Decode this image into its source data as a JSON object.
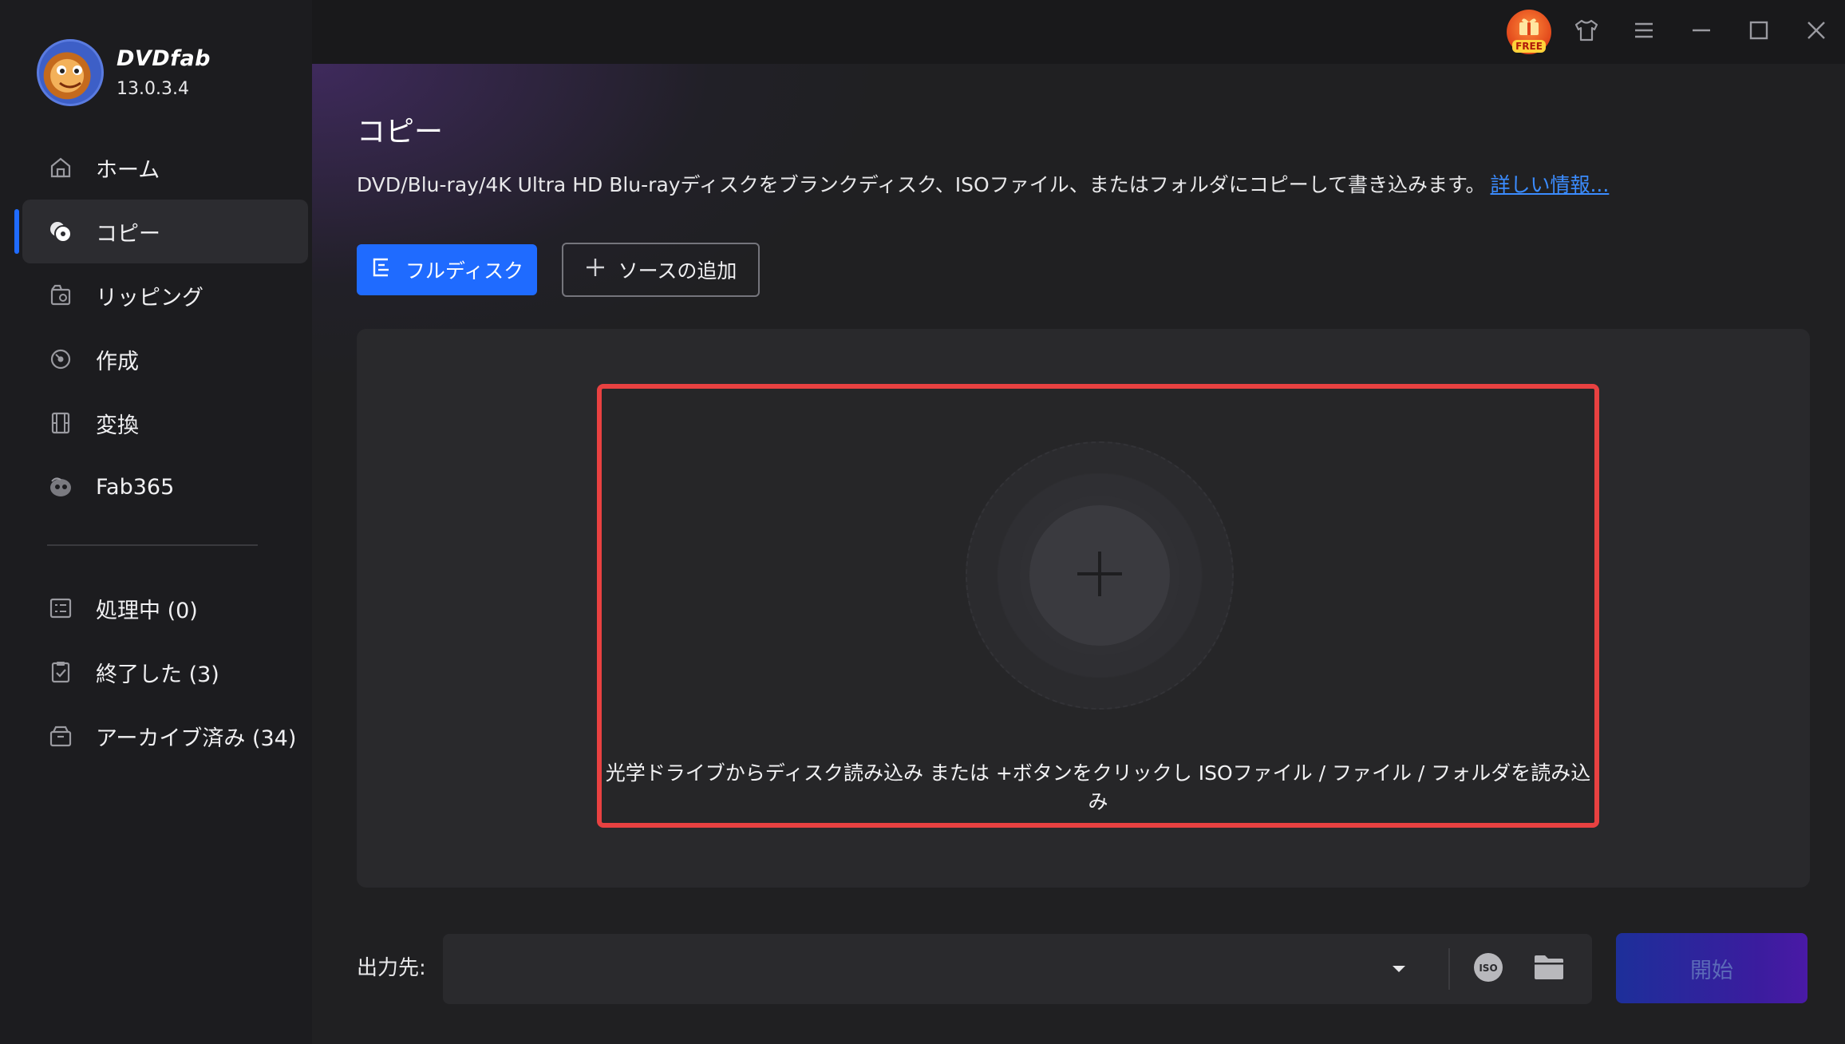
{
  "app": {
    "name": "DVDfab",
    "version": "13.0.3.4"
  },
  "nav": {
    "items": [
      {
        "label": "ホーム",
        "icon": "home-icon"
      },
      {
        "label": "コピー",
        "icon": "copy-disc-icon",
        "active": true
      },
      {
        "label": "リッピング",
        "icon": "ripper-icon"
      },
      {
        "label": "作成",
        "icon": "creator-icon"
      },
      {
        "label": "変換",
        "icon": "converter-icon"
      },
      {
        "label": "Fab365",
        "icon": "fab365-icon"
      }
    ],
    "queue": [
      {
        "label": "処理中 (0)",
        "icon": "processing-icon"
      },
      {
        "label": "終了した (3)",
        "icon": "finished-icon"
      },
      {
        "label": "アーカイブ済み (34)",
        "icon": "archive-icon"
      }
    ]
  },
  "topbar": {
    "free_badge": "FREE"
  },
  "main": {
    "title": "コピー",
    "description": "DVD/Blu-ray/4K Ultra HD Blu-rayディスクをブランクディスク、ISOファイル、またはフォルダにコピーして書き込みます。",
    "more_link": "詳しい情報...",
    "full_disc_button": "フルディスク",
    "add_source_button": "ソースの追加",
    "drop_hint": "光学ドライブからディスク読み込み または +ボタンをクリックし ISOファイル / ファイル / フォルダを読み込み"
  },
  "output": {
    "label": "出力先:",
    "value": "",
    "iso_label": "ISO",
    "start_button": "開始"
  },
  "colors": {
    "accent": "#1f6bff",
    "highlight": "#e84141",
    "link": "#3b8cff"
  }
}
